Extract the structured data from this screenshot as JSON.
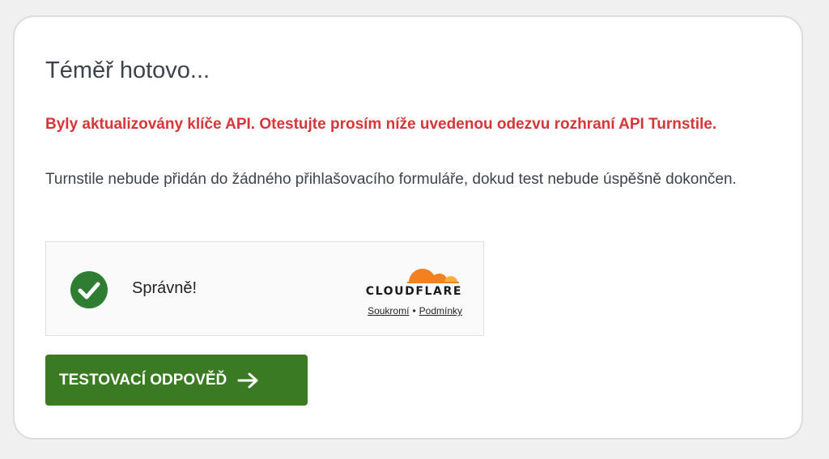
{
  "card": {
    "title": "Téměř hotovo...",
    "alert": "Byly aktualizovány klíče API. Otestujte prosím níže uvedenou odezvu rozhraní API Turnstile.",
    "description": "Turnstile nebude přidán do žádného přihlašovacího formuláře, dokud test nebude úspěšně dokončen."
  },
  "widget": {
    "status_text": "Správně!",
    "brand": "CLOUDFLARE",
    "privacy_link": "Soukromí",
    "separator": "•",
    "terms_link": "Podmínky",
    "icons": {
      "status": "check-circle-icon",
      "logo": "cloudflare-cloud-icon"
    }
  },
  "button": {
    "label": "TESTOVACÍ ODPOVĚĎ",
    "icon": "arrow-right-icon"
  },
  "colors": {
    "alert": "#d63638",
    "success": "#2e7d32",
    "button": "#3a7a22",
    "cloudflare_orange": "#f48120",
    "cloudflare_light": "#faad3f"
  }
}
